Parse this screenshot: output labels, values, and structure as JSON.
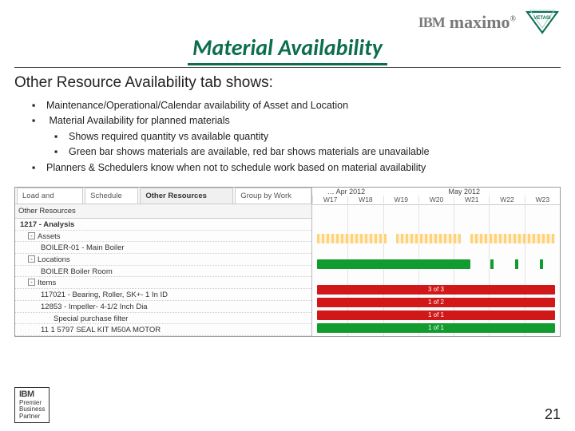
{
  "brand": {
    "ibm": "IBM",
    "maximo": "maximo",
    "reg": "®",
    "vetasi": "VETASI"
  },
  "title": "Material Availability",
  "subhead": "Other Resource Availability tab shows:",
  "bullets": [
    "Maintenance/Operational/Calendar availability of Asset and Location",
    "Material Availability for planned materials",
    "Planners & Schedulers know when not to schedule work based on material availability"
  ],
  "sub_bullets": [
    "Shows required quantity vs available quantity",
    "Green bar shows materials are available, red bar shows materials are unavailable"
  ],
  "screenshot": {
    "tabs": [
      "Load and Availability",
      "Schedule Costs",
      "Other Resources Availability",
      "Group by Work Property"
    ],
    "active_tab_index": 2,
    "left_header": "Other Resources",
    "group_label": "1217 - Analysis",
    "rows": [
      {
        "label": "Assets",
        "type": "group"
      },
      {
        "label": "BOILER-01 - Main Boiler",
        "indent": 2
      },
      {
        "label": "Locations",
        "type": "group"
      },
      {
        "label": "BOILER Boiler Room",
        "indent": 2
      },
      {
        "label": "Items",
        "type": "group"
      },
      {
        "label": "117021 - Bearing, Roller, SK+- 1 In ID",
        "indent": 2
      },
      {
        "label": "12853 - Impeller- 4-1/2 Inch Dia",
        "indent": 2
      },
      {
        "label": "Special purchase filter",
        "indent": 2
      },
      {
        "label": "11 1 5797  SEAL KIT  M50A MOTOR",
        "indent": 2
      }
    ],
    "calendar": {
      "months": [
        {
          "label": "… Apr 2012",
          "left_pct": 6
        },
        {
          "label": "May 2012",
          "left_pct": 55
        }
      ],
      "weeks": [
        "W17",
        "W18",
        "W19",
        "W20",
        "W21",
        "W22",
        "W23"
      ]
    },
    "item_values": [
      "3 of 3",
      "1 of 2",
      "1 of 1",
      "1 of 1"
    ]
  },
  "footer": {
    "ibm": "IBM",
    "line1": "Premier",
    "line2": "Business",
    "line3": "Partner"
  },
  "page_number": "21"
}
